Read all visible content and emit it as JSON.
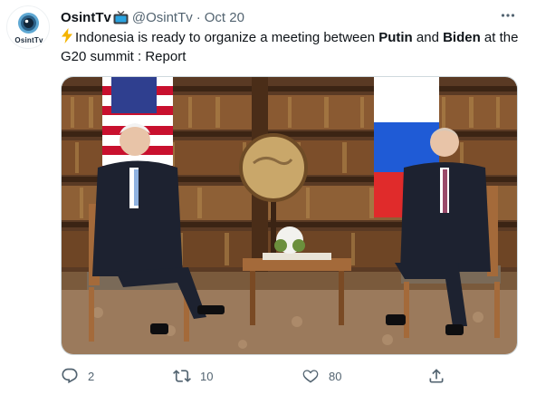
{
  "tweet": {
    "avatar_text": "OsintTv",
    "display_name": "OsintTv",
    "display_name_emoji": "tv-icon",
    "handle": "@OsintTv",
    "separator": "·",
    "timestamp": "Oct 20",
    "text": {
      "prefix": "Indonesia is ready to organize a meeting between ",
      "name1": "Putin",
      "middle": " and ",
      "name2": "Biden",
      "suffix": " at the G20 summit : Report"
    },
    "media_description_icon": "photo",
    "actions": {
      "reply_count": "2",
      "retweet_count": "10",
      "like_count": "80"
    }
  },
  "colors": {
    "text_primary": "#0f1419",
    "text_secondary": "#536471",
    "lightning": "#f4b400"
  }
}
